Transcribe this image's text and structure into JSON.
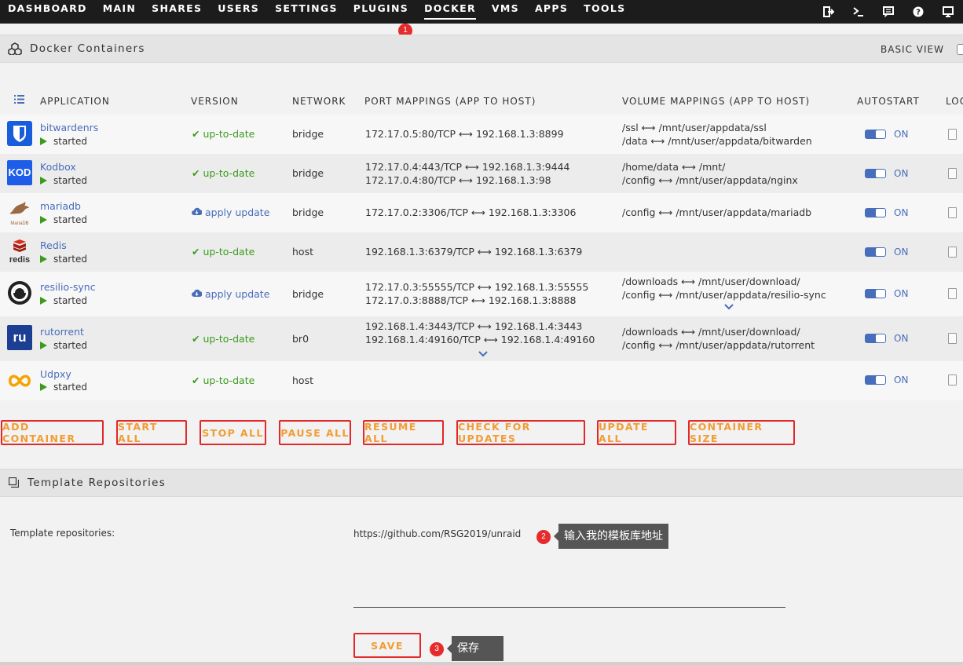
{
  "nav": {
    "items": [
      "DASHBOARD",
      "MAIN",
      "SHARES",
      "USERS",
      "SETTINGS",
      "PLUGINS",
      "DOCKER",
      "VMS",
      "APPS",
      "TOOLS"
    ],
    "active": "DOCKER",
    "icons": [
      "logout-icon",
      "terminal-icon",
      "feedback-icon",
      "help-icon",
      "monitor-icon"
    ]
  },
  "markers": {
    "m1": "1",
    "m2": "2",
    "m3": "3"
  },
  "docker_panel": {
    "title": "Docker Containers",
    "basic_view_label": "BASIC VIEW",
    "headers": {
      "application": "APPLICATION",
      "version": "VERSION",
      "network": "NETWORK",
      "ports": "PORT MAPPINGS (APP TO HOST)",
      "volumes": "VOLUME MAPPINGS (APP TO HOST)",
      "autostart": "AUTOSTART",
      "log": "LOG"
    }
  },
  "containers": [
    {
      "name": "bitwardenrs",
      "state": "started",
      "version": "up-to-date",
      "network": "bridge",
      "ports": [
        "172.17.0.5:80/TCP ⟷ 192.168.1.3:8899"
      ],
      "volumes": [
        "/ssl ⟷ /mnt/user/appdata/ssl",
        "/data ⟷ /mnt/user/appdata/bitwarden"
      ],
      "autostart": "ON"
    },
    {
      "name": "Kodbox",
      "state": "started",
      "version": "up-to-date",
      "network": "bridge",
      "ports": [
        "172.17.0.4:443/TCP ⟷ 192.168.1.3:9444",
        "172.17.0.4:80/TCP ⟷ 192.168.1.3:98"
      ],
      "volumes": [
        "/home/data ⟷ /mnt/",
        "/config ⟷ /mnt/user/appdata/nginx"
      ],
      "autostart": "ON"
    },
    {
      "name": "mariadb",
      "state": "started",
      "version": "apply update",
      "network": "bridge",
      "ports": [
        "172.17.0.2:3306/TCP ⟷ 192.168.1.3:3306"
      ],
      "volumes": [
        "/config ⟷ /mnt/user/appdata/mariadb"
      ],
      "autostart": "ON"
    },
    {
      "name": "Redis",
      "state": "started",
      "version": "up-to-date",
      "network": "host",
      "ports": [
        "192.168.1.3:6379/TCP ⟷ 192.168.1.3:6379"
      ],
      "volumes": [],
      "autostart": "ON"
    },
    {
      "name": "resilio-sync",
      "state": "started",
      "version": "apply update",
      "network": "bridge",
      "ports": [
        "172.17.0.3:55555/TCP ⟷ 192.168.1.3:55555",
        "172.17.0.3:8888/TCP ⟷ 192.168.1.3:8888"
      ],
      "volumes": [
        "/downloads ⟷ /mnt/user/download/",
        "/config ⟷ /mnt/user/appdata/resilio-sync"
      ],
      "autostart": "ON"
    },
    {
      "name": "rutorrent",
      "state": "started",
      "version": "up-to-date",
      "network": "br0",
      "ports": [
        "192.168.1.4:3443/TCP ⟷ 192.168.1.4:3443",
        "192.168.1.4:49160/TCP ⟷ 192.168.1.4:49160"
      ],
      "volumes": [
        "/downloads ⟷ /mnt/user/download/",
        "/config ⟷ /mnt/user/appdata/rutorrent"
      ],
      "autostart": "ON"
    },
    {
      "name": "Udpxy",
      "state": "started",
      "version": "up-to-date",
      "network": "host",
      "ports": [],
      "volumes": [],
      "autostart": "ON"
    }
  ],
  "icon_text": {
    "kodbox": "KOD",
    "mariadb": "MariaDB",
    "redis": "redis",
    "rutorrent": "ru"
  },
  "buttons": {
    "add": "ADD CONTAINER",
    "start_all": "START ALL",
    "stop_all": "STOP ALL",
    "pause_all": "PAUSE ALL",
    "resume_all": "RESUME ALL",
    "check_updates": "CHECK FOR UPDATES",
    "update_all": "UPDATE ALL",
    "container_size": "CONTAINER SIZE"
  },
  "template_panel": {
    "title": "Template Repositories",
    "label": "Template repositories:",
    "value": "https://github.com/RSG2019/unraid",
    "save": "SAVE"
  },
  "annotations": {
    "tip2": "输入我的模板库地址",
    "tip3": "保存"
  },
  "colors": {
    "link": "#486dba",
    "ok": "#3a9b1c",
    "button_border": "#e22828",
    "button_text": "#f29c33",
    "marker": "#e52b2b"
  }
}
